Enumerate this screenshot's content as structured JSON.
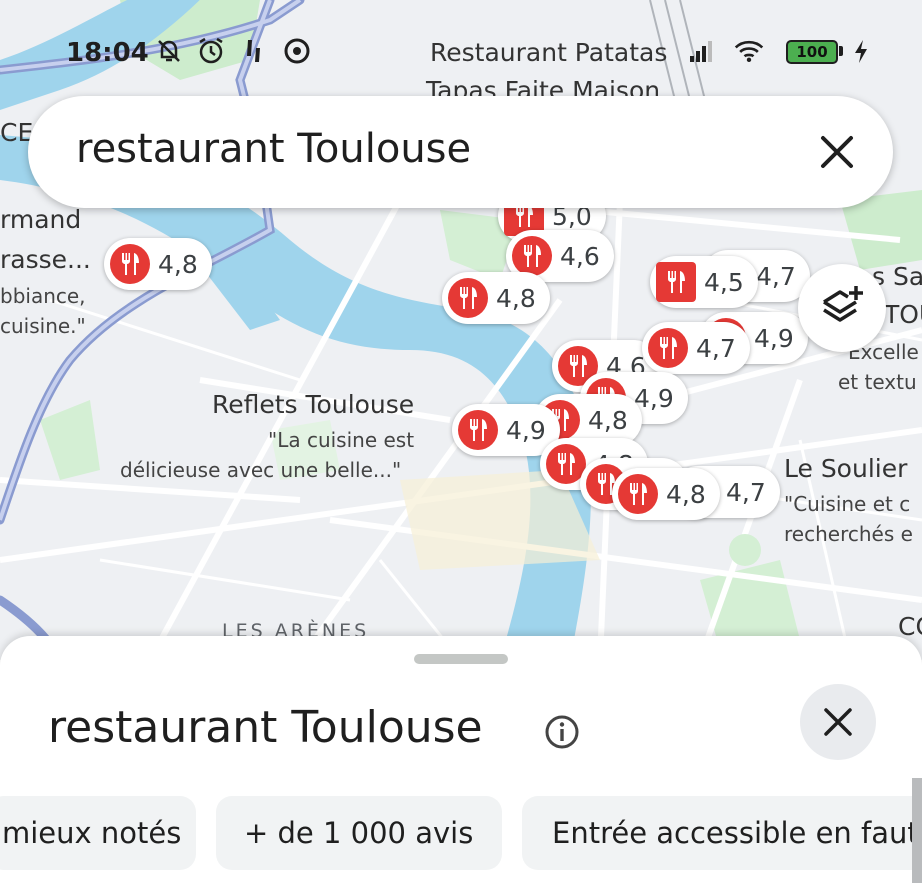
{
  "status_bar": {
    "time": "18:04",
    "battery_level": "100",
    "icons": [
      "notifications-off-icon",
      "alarm-icon",
      "location-icon",
      "vpn-icon",
      "signal-icon",
      "wifi-icon",
      "charging-icon"
    ]
  },
  "map": {
    "labels": {
      "patatas_1": "Restaurant Patatas",
      "patatas_2": "Tapas Faite Maison",
      "left_1": "rmand",
      "left_2": "rasse...",
      "left_3": "bbiance,",
      "left_4": "cuisine.\"",
      "reflets_name": "Reflets Toulouse",
      "reflets_quote_1": "\"La cuisine est",
      "reflets_quote_2": "délicieuse avec une  belle...\"",
      "soulier_name": "Le Soulier",
      "soulier_quote_1": "\"Cuisine et c",
      "soulier_quote_2": "recherchés e",
      "right_1": "s Sa",
      "right_2": "TOU",
      "right_3": "Excelle",
      "right_4": "et textu",
      "area": "LES ARÈNES",
      "ce": "CE",
      "co": "CO"
    },
    "pins": [
      "4,8",
      "5,0",
      "4,6",
      "4,8",
      "4,5",
      "4,7",
      "4,9",
      "4,8",
      "4,7",
      "4,6",
      "4,9",
      "4,8",
      "4,9",
      "4,8",
      "4,7",
      "4,8"
    ]
  },
  "search": {
    "query": "restaurant Toulouse"
  },
  "sheet": {
    "title": "restaurant Toulouse",
    "chips": [
      "mieux notés",
      "+ de 1 000 avis",
      "Entrée accessible en fauteuil"
    ]
  },
  "colors": {
    "pin_red": "#e53935",
    "water": "#9fd4ec",
    "park": "#cdeccd",
    "road_highway": "#8a9bd0"
  }
}
